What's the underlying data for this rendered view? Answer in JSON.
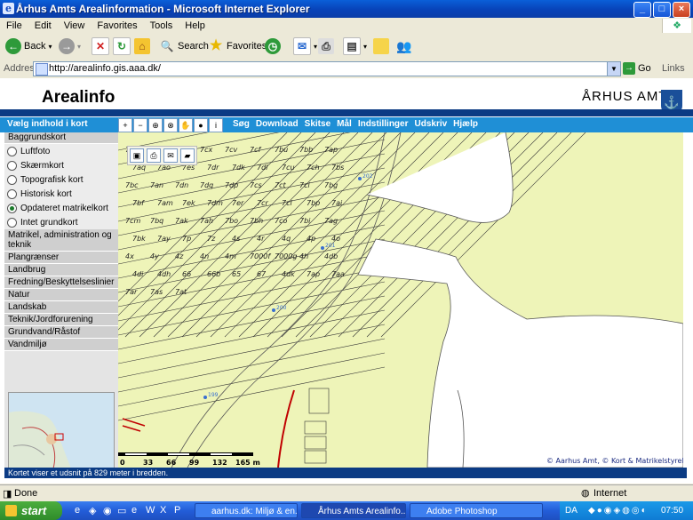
{
  "window": {
    "title": "Århus Amts Arealinformation - Microsoft Internet Explorer"
  },
  "menubar": [
    "File",
    "Edit",
    "View",
    "Favorites",
    "Tools",
    "Help"
  ],
  "toolbar": {
    "back": "Back",
    "search": "Search",
    "favorites": "Favorites"
  },
  "address": {
    "label": "Address",
    "url": "http://arealinfo.gis.aaa.dk/",
    "go": "Go",
    "links": "Links"
  },
  "site": {
    "title": "Arealinfo",
    "org": "ÅRHUS AMT"
  },
  "nav": {
    "panel_title": "Vælg indhold i kort",
    "links": [
      "Søg",
      "Download",
      "Skitse",
      "Mål",
      "Indstillinger",
      "Udskriv",
      "Hjælp"
    ]
  },
  "sidebar": {
    "section": "Baggrundskort",
    "options": [
      {
        "label": "Luftfoto",
        "selected": false
      },
      {
        "label": "Skærmkort",
        "selected": false
      },
      {
        "label": "Topografisk kort",
        "selected": false
      },
      {
        "label": "Historisk kort",
        "selected": false
      },
      {
        "label": "Opdateret matrikelkort",
        "selected": true
      },
      {
        "label": "Intet grundkort",
        "selected": false
      }
    ],
    "categories": [
      "Matrikel, administration og teknik",
      "Plangrænser",
      "Landbrug",
      "Fredning/Beskyttelseslinier",
      "Natur",
      "Landskab",
      "Teknik/Jordforurening",
      "Grundvand/Råstof",
      "Vandmiljø"
    ]
  },
  "map": {
    "scale_ticks": [
      "0",
      "33",
      "66",
      "99",
      "132",
      "165 m"
    ],
    "copyright": "© Aarhus Amt, © Kort & Matrikelstyrelsen",
    "parcels": [
      "7df",
      "7dd",
      "7cy",
      "7cx",
      "7cv",
      "7cf",
      "7bu",
      "7bb",
      "7ap",
      "7aq",
      "7ao",
      "7es",
      "7dr",
      "7dk",
      "7dl",
      "7cu",
      "7ch",
      "7bs",
      "7bc",
      "7an",
      "7dn",
      "7dq",
      "7dp",
      "7cs",
      "7ct",
      "7ci",
      "7bg",
      "7bf",
      "7am",
      "7ek",
      "7dm",
      "7er",
      "7cr",
      "7cl",
      "7bp",
      "7ai",
      "7cm",
      "7bq",
      "7ak",
      "7ah",
      "7bo",
      "7bh",
      "7co",
      "7bi",
      "7ag",
      "7bk",
      "7ay",
      "7p",
      "7z",
      "4s",
      "4r",
      "4q",
      "4p",
      "4o",
      "4x",
      "4y",
      "4z",
      "4n",
      "4m",
      "7000f",
      "7000g",
      "4h",
      "4db",
      "4di",
      "4dh",
      "66",
      "66b",
      "65",
      "67",
      "4dk",
      "7ap",
      "7aa",
      "7ar",
      "7as",
      "7at"
    ],
    "point_labels": [
      "202",
      "201",
      "200",
      "199"
    ]
  },
  "status_bar": {
    "scale_note": "Kortet viser et udsnit på 829 meter i bredden.",
    "done": "Done",
    "zone": "Internet"
  },
  "taskbar": {
    "start": "start",
    "items": [
      "aarhus.dk: Miljø & en...",
      "Århus Amts Arealinfo...",
      "Adobe Photoshop"
    ],
    "lang": "DA",
    "clock": "07:50"
  }
}
